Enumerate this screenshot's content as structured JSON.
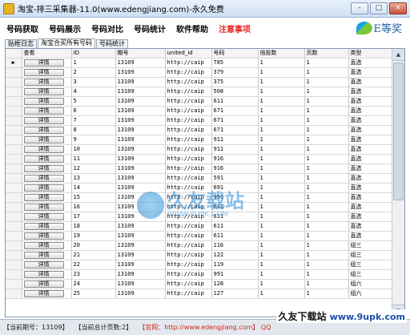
{
  "window": {
    "title": "淘宝-排三采集器-11.0(www.edengjiang.com)-永久免费",
    "buttons": [
      "-",
      "□",
      "×"
    ]
  },
  "menu": [
    "号码获取",
    "号码展示",
    "号码对比",
    "号码统计",
    "软件帮助"
  ],
  "menu_warning": "注意事项",
  "brand": {
    "text": "E等奖"
  },
  "tabs": [
    "贴框日志",
    "淘宝合买所有号码",
    "号码统计"
  ],
  "table": {
    "columns": [
      "查看",
      "ID",
      "期号",
      "united_id",
      "号码",
      "倍投数",
      "页数",
      "类型"
    ],
    "button_label": "详情",
    "rows": [
      [
        "1",
        "13109",
        "http://caip",
        "785",
        "1",
        "1",
        "直选"
      ],
      [
        "2",
        "13109",
        "http://caip",
        "379",
        "1",
        "1",
        "直选"
      ],
      [
        "3",
        "13109",
        "http://caip",
        "375",
        "1",
        "1",
        "直选"
      ],
      [
        "4",
        "13109",
        "http://caip",
        "508",
        "1",
        "1",
        "直选"
      ],
      [
        "5",
        "13109",
        "http://caip",
        "611",
        "1",
        "1",
        "直选"
      ],
      [
        "6",
        "13109",
        "http://caip",
        "671",
        "1",
        "1",
        "直选"
      ],
      [
        "7",
        "13109",
        "http://caip",
        "671",
        "1",
        "1",
        "直选"
      ],
      [
        "8",
        "13109",
        "http://caip",
        "671",
        "1",
        "1",
        "直选"
      ],
      [
        "9",
        "13109",
        "http://caip",
        "911",
        "1",
        "1",
        "直选"
      ],
      [
        "10",
        "13109",
        "http://caip",
        "911",
        "1",
        "1",
        "直选"
      ],
      [
        "11",
        "13109",
        "http://caip",
        "916",
        "1",
        "1",
        "直选"
      ],
      [
        "12",
        "13109",
        "http://caip",
        "916",
        "1",
        "1",
        "直选"
      ],
      [
        "13",
        "13109",
        "http://caip",
        "591",
        "1",
        "1",
        "直选"
      ],
      [
        "14",
        "13109",
        "http://caip",
        "691",
        "1",
        "1",
        "直选"
      ],
      [
        "15",
        "13109",
        "http://caip",
        "991",
        "1",
        "1",
        "直选"
      ],
      [
        "16",
        "13109",
        "http://caip",
        "611",
        "1",
        "1",
        "直选"
      ],
      [
        "17",
        "13109",
        "http://caip",
        "611",
        "1",
        "1",
        "直选"
      ],
      [
        "18",
        "13109",
        "http://caip",
        "611",
        "1",
        "1",
        "直选"
      ],
      [
        "19",
        "13109",
        "http://caip",
        "611",
        "1",
        "1",
        "直选"
      ],
      [
        "20",
        "13109",
        "http://caip",
        "116",
        "1",
        "1",
        "组三"
      ],
      [
        "21",
        "13109",
        "http://caip",
        "122",
        "1",
        "1",
        "组三"
      ],
      [
        "22",
        "13109",
        "http://caip",
        "119",
        "1",
        "1",
        "组三"
      ],
      [
        "23",
        "13109",
        "http://caip",
        "991",
        "1",
        "1",
        "组三"
      ],
      [
        "24",
        "13109",
        "http://caip",
        "128",
        "1",
        "1",
        "组六"
      ],
      [
        "25",
        "13109",
        "http://caip",
        "127",
        "1",
        "1",
        "组六"
      ]
    ]
  },
  "watermark": {
    "title": "久友载站",
    "url": "WWW.9UPK.COM"
  },
  "status": {
    "period": "【当前期号：13109】",
    "pages": "【当前总计页数:2】",
    "site": "【官网：http://www.edengjiang.com】 QQ",
    "corner": "久友下载站",
    "corner_url": "www.9upk.com"
  }
}
